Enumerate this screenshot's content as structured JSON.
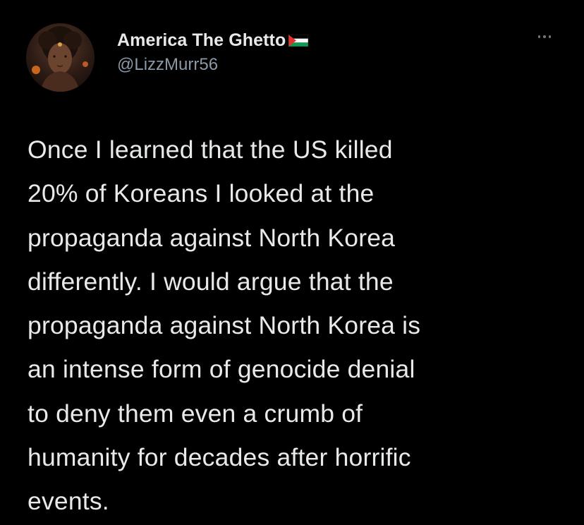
{
  "tweet": {
    "display_name": "America The Ghetto",
    "handle": "@LizzMurr56",
    "text": "Once I learned that the US killed\n20% of Koreans I looked at the\npropaganda  against North Korea\ndifferently. I would argue that the\npropaganda against North Korea is\nan intense form of genocide denial\nto deny them even a crumb of\nhumanity for decades after horrific\nevents."
  },
  "icons": {
    "flag": "palestine-flag-icon",
    "more": "more-options-icon",
    "avatar": "avatar"
  },
  "colors": {
    "background": "#000000",
    "text_primary": "#e7e9ea",
    "text_secondary": "#8b98a5"
  }
}
